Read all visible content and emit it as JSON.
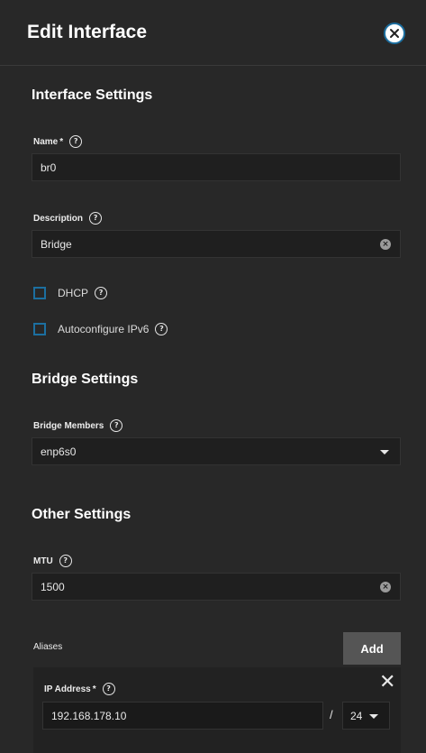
{
  "header": {
    "title": "Edit Interface",
    "close_icon": "close-circle-icon"
  },
  "interface_settings": {
    "section_title": "Interface Settings",
    "name": {
      "label": "Name",
      "required_mark": "*",
      "value": "br0"
    },
    "description": {
      "label": "Description",
      "value": "Bridge"
    },
    "dhcp": {
      "label": "DHCP",
      "checked": false
    },
    "autoconfigure_ipv6": {
      "label": "Autoconfigure IPv6",
      "checked": false
    }
  },
  "bridge_settings": {
    "section_title": "Bridge Settings",
    "bridge_members": {
      "label": "Bridge Members",
      "value": "enp6s0"
    }
  },
  "other_settings": {
    "section_title": "Other Settings",
    "mtu": {
      "label": "MTU",
      "value": "1500"
    }
  },
  "aliases": {
    "label": "Aliases",
    "add_label": "Add",
    "ip_address": {
      "label": "IP Address",
      "required_mark": "*",
      "value": "192.168.178.10",
      "separator": "/",
      "netmask": "24"
    }
  },
  "colors": {
    "accent": "#1c6fa0",
    "background": "#282828",
    "field": "#1f1f1f"
  }
}
